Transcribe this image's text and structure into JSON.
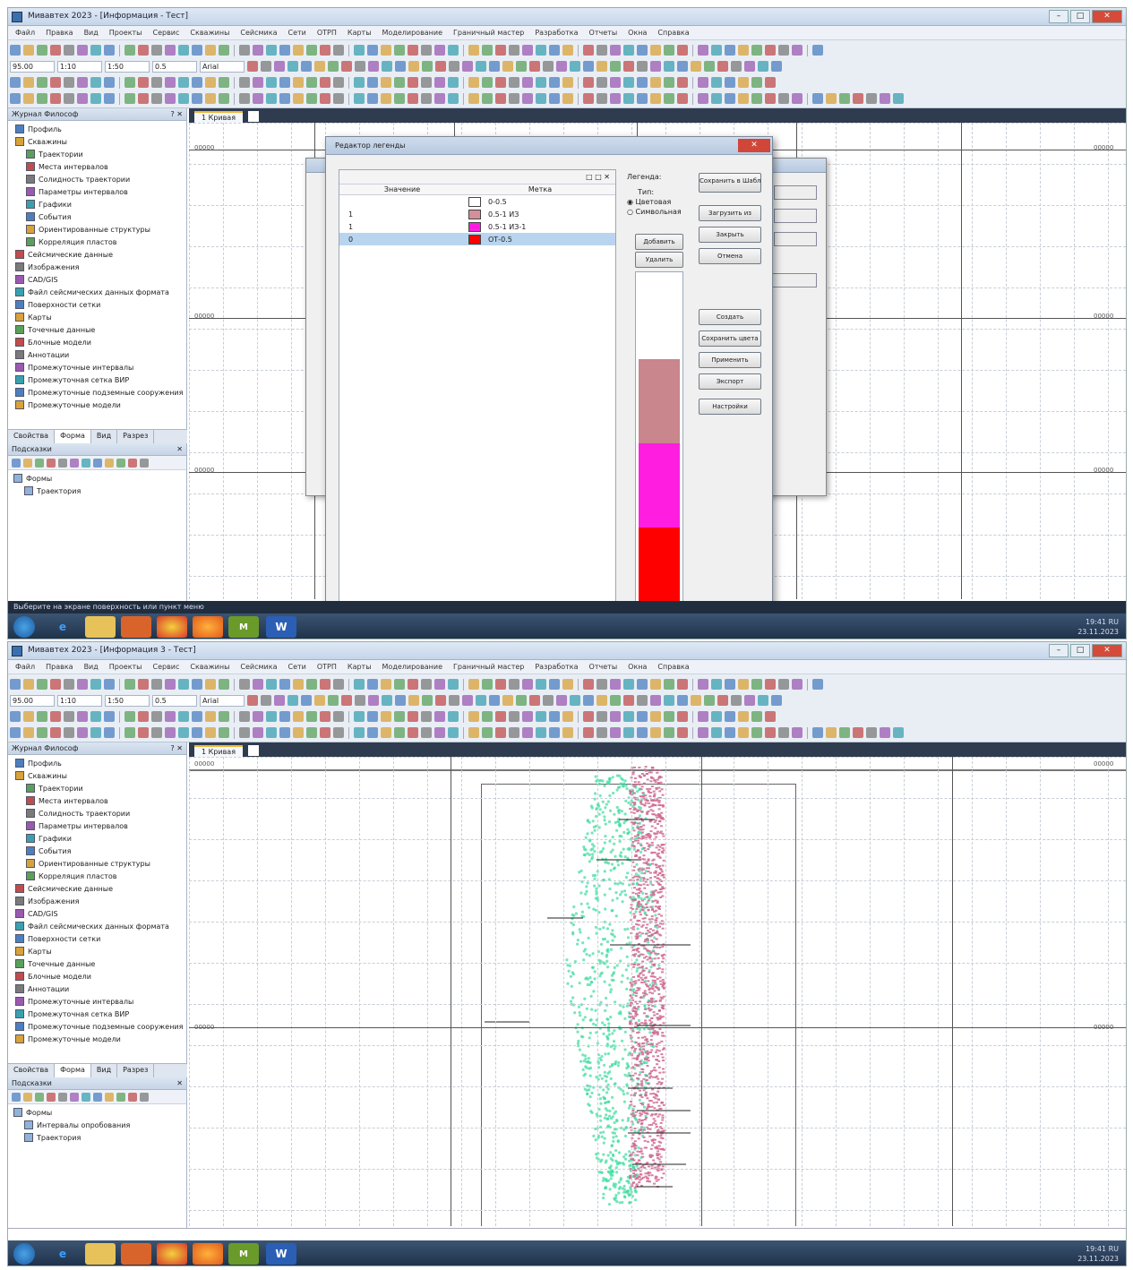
{
  "top_screen": {
    "title": "Мивавтех 2023 - [Информация - Тест]",
    "menu": [
      "Файл",
      "Правка",
      "Вид",
      "Проекты",
      "Сервис",
      "Скважины",
      "Сейсмика",
      "Сети",
      "ОТРП",
      "Карты",
      "Моделирование",
      "Граничный мастер",
      "Разработка",
      "Отчеты",
      "Окна",
      "Справка"
    ],
    "toolbar_inputs": [
      "95.00",
      "1:10",
      "1:50",
      "0.5",
      "Arial"
    ],
    "tree_header": "Журнал Философ",
    "tree_items": [
      "Профиль",
      "Скважины",
      "Траектории",
      "Места интервалов",
      "Солидность траектории",
      "Параметры интервалов",
      "Графики",
      "События",
      "Ориентированные структуры",
      "Корреляция пластов",
      "Сейсмические данные",
      "Изображения",
      "CAD/GIS",
      "Файл сейсмических данных формата",
      "Поверхности сетки",
      "Карты",
      "Точечные данные",
      "Блочные модели",
      "Аннотации",
      "Промежуточные интервалы",
      "Промежуточная сетка ВИР",
      "Промежуточные подземные сооружения",
      "Промежуточные модели"
    ],
    "panel_tabs": [
      "Свойства",
      "Форма",
      "Вид",
      "Разрез"
    ],
    "lower_header": "Подсказки",
    "lower_items": [
      "Формы",
      "Траектория"
    ],
    "doc_tab": "1 Кривая",
    "axis_labels": [
      "00000",
      "00000",
      "00000",
      "00000",
      "00000",
      "00000"
    ],
    "status_text": "Выберите на экране поверхность или пункт меню",
    "tray_text": "19:41 RU",
    "tray_date": "23.11.2023",
    "dialog": {
      "title": "Редактор легенды",
      "col_value": "Значение",
      "col_name": "Метка",
      "list_tools": "□ □ ✕",
      "rows": [
        {
          "value": "",
          "name": "0-0.5",
          "color": "#ffffff"
        },
        {
          "value": "1",
          "name": "0.5-1 ИЗ",
          "color": "#d4909a"
        },
        {
          "value": "1",
          "name": "0.5-1 ИЗ-1",
          "color": "#ff1de0"
        },
        {
          "value": "0",
          "name": "ОТ-0.5",
          "color": "#ff0000"
        }
      ],
      "side_label": "Легенда:",
      "side_type": "Тип:",
      "radio_1": "Цветовая",
      "radio_2": "Символьная",
      "btn_apply_small": "Добавить",
      "btn_remove_small": "Удалить",
      "right_buttons": [
        "Сохранить в Шаблон",
        "Загрузить из",
        "Закрыть",
        "Отмена",
        "Создать",
        "Сохранить цвета",
        "Применить",
        "Экспорт",
        "Настройки"
      ],
      "preview_bands": [
        {
          "color": "#ffffff",
          "fraction": 0.25
        },
        {
          "color": "#c9868c",
          "fraction": 0.25
        },
        {
          "color": "#ff1de0",
          "fraction": 0.25
        },
        {
          "color": "#ff0000",
          "fraction": 0.25
        }
      ]
    }
  },
  "bottom_screen": {
    "title": "Мивавтех 2023 - [Информация 3 - Тест]",
    "tree_header": "Журнал Философ",
    "lower_header": "Подсказки",
    "lower_items": [
      "Формы",
      "Интервалы опробования",
      "Траектория"
    ],
    "doc_tab": "1 Кривая",
    "axis_labels": [
      "00000",
      "00000",
      "00000",
      "00000"
    ],
    "tray_text": "19:41 RU",
    "tray_date": "23.11.2023"
  },
  "colors": {
    "pink": "#d06a92",
    "green": "#3ddba0",
    "accent": "#f0b93a"
  }
}
